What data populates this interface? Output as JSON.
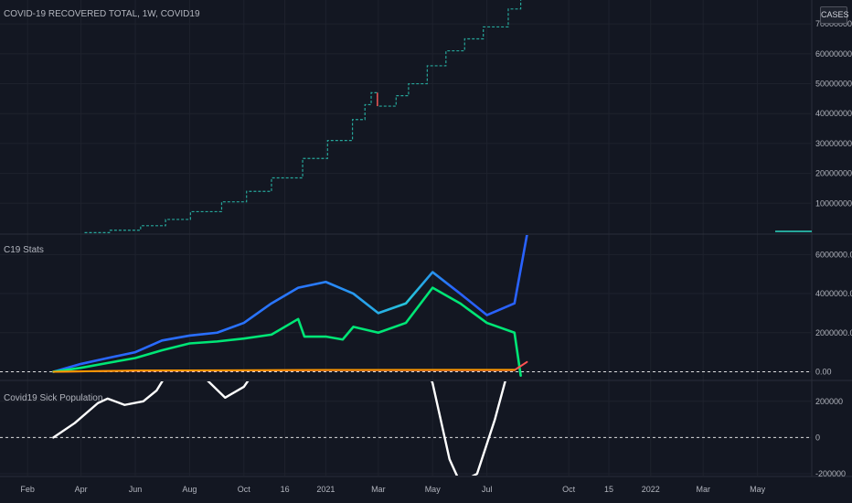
{
  "header": {
    "title": "COVID-19 RECOVERED TOTAL, 1W, COVID19",
    "cases_button": "CASES"
  },
  "panes": {
    "stats_title": "C19 Stats",
    "sick_title": "Covid19 Sick Population"
  },
  "colors": {
    "background": "#131722",
    "grid": "#1e222d",
    "step_series": "#26a69a",
    "step_down": "#ef5350",
    "blue_series": "#2962ff",
    "green_series": "#00e676",
    "white_series": "#ffffff",
    "red_series": "#ff5252",
    "orange_series": "#ff9800",
    "axis_text": "#b2b5be"
  },
  "chart_data": [
    {
      "type": "line",
      "pane": "main",
      "title": "COVID-19 RECOVERED TOTAL, 1W, COVID19",
      "x_type": "date",
      "series": [
        {
          "name": "COVID-19 RECOVERED TOTAL",
          "style": "step",
          "points": [
            [
              "2020-04-05",
              200000
            ],
            [
              "2020-05-03",
              1000000
            ],
            [
              "2020-06-07",
              2500000
            ],
            [
              "2020-07-05",
              4600000
            ],
            [
              "2020-08-02",
              7200000
            ],
            [
              "2020-09-06",
              10500000
            ],
            [
              "2020-10-04",
              14000000
            ],
            [
              "2020-11-01",
              18500000
            ],
            [
              "2020-12-06",
              25000000
            ],
            [
              "2021-01-03",
              31000000
            ],
            [
              "2021-01-31",
              38000000
            ],
            [
              "2021-02-14",
              43000000
            ],
            [
              "2021-02-21",
              47000000
            ],
            [
              "2021-02-28",
              42500000
            ],
            [
              "2021-03-21",
              46000000
            ],
            [
              "2021-04-04",
              50000000
            ],
            [
              "2021-04-25",
              56000000
            ],
            [
              "2021-05-16",
              61000000
            ],
            [
              "2021-06-06",
              65000000
            ],
            [
              "2021-06-27",
              69000000
            ],
            [
              "2021-07-25",
              75000000
            ],
            [
              "2021-08-08",
              78000000
            ]
          ]
        }
      ],
      "y_ticks": [
        "10000000",
        "20000000",
        "30000000",
        "40000000",
        "50000000",
        "60000000",
        "70000000"
      ],
      "ylim": [
        0,
        78000000
      ]
    },
    {
      "type": "line",
      "pane": "stats",
      "title": "C19 Stats",
      "x_type": "date",
      "series": [
        {
          "color": "blue_to_teal",
          "points": [
            [
              "2020-03-01",
              0
            ],
            [
              "2020-04-01",
              400000
            ],
            [
              "2020-05-01",
              700000
            ],
            [
              "2020-06-01",
              1000000
            ],
            [
              "2020-07-01",
              1600000
            ],
            [
              "2020-08-01",
              1850000
            ],
            [
              "2020-09-01",
              2000000
            ],
            [
              "2020-10-01",
              2500000
            ],
            [
              "2020-11-01",
              3500000
            ],
            [
              "2020-12-01",
              4300000
            ],
            [
              "2021-01-01",
              4600000
            ],
            [
              "2021-02-01",
              4000000
            ],
            [
              "2021-03-01",
              3000000
            ],
            [
              "2021-04-01",
              3500000
            ],
            [
              "2021-05-01",
              5100000
            ],
            [
              "2021-06-01",
              4000000
            ],
            [
              "2021-07-01",
              2900000
            ],
            [
              "2021-08-01",
              3500000
            ],
            [
              "2021-08-15",
              7000000
            ]
          ]
        },
        {
          "color": "green",
          "points": [
            [
              "2020-03-01",
              0
            ],
            [
              "2020-04-01",
              200000
            ],
            [
              "2020-05-01",
              450000
            ],
            [
              "2020-06-01",
              700000
            ],
            [
              "2020-07-01",
              1100000
            ],
            [
              "2020-08-01",
              1450000
            ],
            [
              "2020-09-01",
              1550000
            ],
            [
              "2020-10-01",
              1700000
            ],
            [
              "2020-11-01",
              1900000
            ],
            [
              "2020-12-01",
              2700000
            ],
            [
              "2020-12-08",
              1800000
            ],
            [
              "2021-01-01",
              1800000
            ],
            [
              "2021-01-20",
              1650000
            ],
            [
              "2021-02-01",
              2300000
            ],
            [
              "2021-03-01",
              2000000
            ],
            [
              "2021-04-01",
              2500000
            ],
            [
              "2021-05-01",
              4300000
            ],
            [
              "2021-06-01",
              3500000
            ],
            [
              "2021-07-01",
              2500000
            ],
            [
              "2021-08-01",
              2000000
            ],
            [
              "2021-08-08",
              -200000
            ]
          ]
        },
        {
          "color": "red",
          "points": [
            [
              "2020-03-01",
              0
            ],
            [
              "2020-06-01",
              50000
            ],
            [
              "2021-01-01",
              80000
            ],
            [
              "2021-08-01",
              80000
            ],
            [
              "2021-08-15",
              500000
            ]
          ]
        },
        {
          "color": "orange",
          "points": [
            [
              "2020-03-01",
              0
            ],
            [
              "2020-06-01",
              60000
            ],
            [
              "2021-01-01",
              90000
            ],
            [
              "2021-08-01",
              100000
            ]
          ]
        }
      ],
      "y_ticks": [
        "0.00",
        "2000000.00",
        "4000000.00",
        "6000000.00"
      ],
      "ylim": [
        -400000,
        7000000
      ]
    },
    {
      "type": "line",
      "pane": "sick",
      "title": "Covid19 Sick Population",
      "x_type": "date",
      "series": [
        {
          "color": "white",
          "points": [
            [
              "2020-03-01",
              0
            ],
            [
              "2020-03-25",
              80000
            ],
            [
              "2020-04-20",
              190000
            ],
            [
              "2020-05-01",
              215000
            ],
            [
              "2020-05-20",
              180000
            ],
            [
              "2020-06-10",
              200000
            ],
            [
              "2020-06-25",
              260000
            ],
            [
              "2020-07-10",
              380000
            ],
            [
              "2020-08-20",
              320000
            ],
            [
              "2020-09-10",
              220000
            ],
            [
              "2020-10-01",
              280000
            ],
            [
              "2020-11-01",
              500000
            ],
            [
              "2021-04-15",
              500000
            ],
            [
              "2021-05-01",
              300000
            ],
            [
              "2021-05-20",
              -120000
            ],
            [
              "2021-06-01",
              -250000
            ],
            [
              "2021-06-20",
              -200000
            ],
            [
              "2021-07-10",
              100000
            ],
            [
              "2021-08-01",
              500000
            ]
          ]
        }
      ],
      "y_ticks": [
        "-200000",
        "0",
        "200000"
      ],
      "ylim": [
        -210000,
        310000
      ]
    }
  ],
  "x_axis": {
    "ticks": [
      {
        "label": "Feb",
        "date": "2020-02-01"
      },
      {
        "label": "Apr",
        "date": "2020-04-01"
      },
      {
        "label": "Jun",
        "date": "2020-06-01"
      },
      {
        "label": "Aug",
        "date": "2020-08-01"
      },
      {
        "label": "Oct",
        "date": "2020-10-01"
      },
      {
        "label": "16",
        "date": "2020-11-16"
      },
      {
        "label": "2021",
        "date": "2021-01-01"
      },
      {
        "label": "Mar",
        "date": "2021-03-01"
      },
      {
        "label": "May",
        "date": "2021-05-01"
      },
      {
        "label": "Jul",
        "date": "2021-07-01"
      },
      {
        "label": "Oct",
        "date": "2021-10-01"
      },
      {
        "label": "15",
        "date": "2021-11-15"
      },
      {
        "label": "2022",
        "date": "2022-01-01"
      },
      {
        "label": "Mar",
        "date": "2022-03-01"
      },
      {
        "label": "May",
        "date": "2022-05-01"
      }
    ],
    "range": [
      "2020-01-01",
      "2022-07-01"
    ]
  }
}
